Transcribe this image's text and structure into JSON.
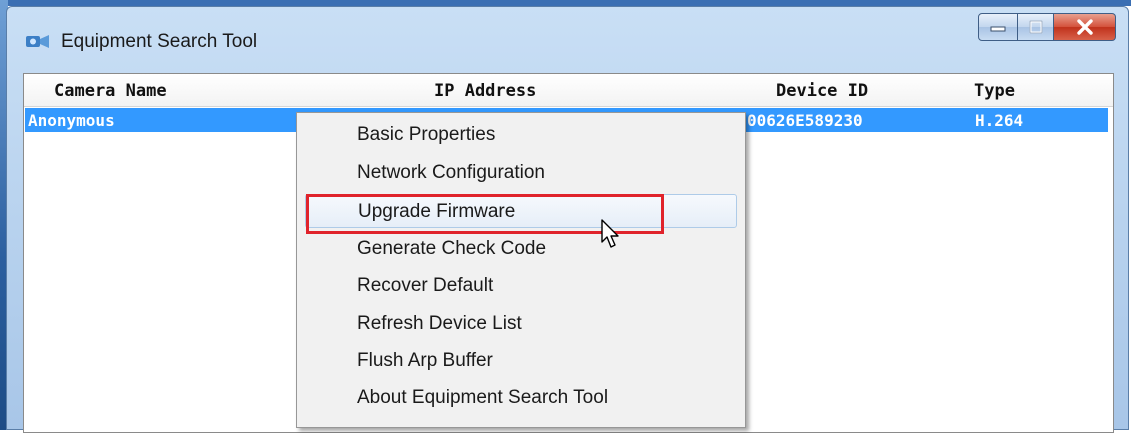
{
  "window": {
    "title": "Equipment Search Tool",
    "icon": "camera-network-icon",
    "controls": [
      "minimize-icon",
      "maximize-icon",
      "close-icon"
    ]
  },
  "list": {
    "columns": [
      "Camera Name",
      "IP Address",
      "Device ID",
      "Type"
    ],
    "rows": [
      {
        "camera_name": "Anonymous",
        "ip_address": "",
        "device_id": "00626E589230",
        "type": "H.264",
        "selected": true
      }
    ]
  },
  "context_menu": {
    "items": [
      "Basic Properties",
      "Network Configuration",
      "Upgrade Firmware",
      "Generate Check Code",
      "Recover Default",
      "Refresh Device List",
      "Flush Arp Buffer",
      "About Equipment Search Tool"
    ],
    "hovered_item": "Upgrade Firmware",
    "annotation_color": "#e0232b"
  },
  "colors": {
    "selection": "#3399ff",
    "menu_background": "#f1f1f1",
    "close_button": "#c7412b"
  }
}
